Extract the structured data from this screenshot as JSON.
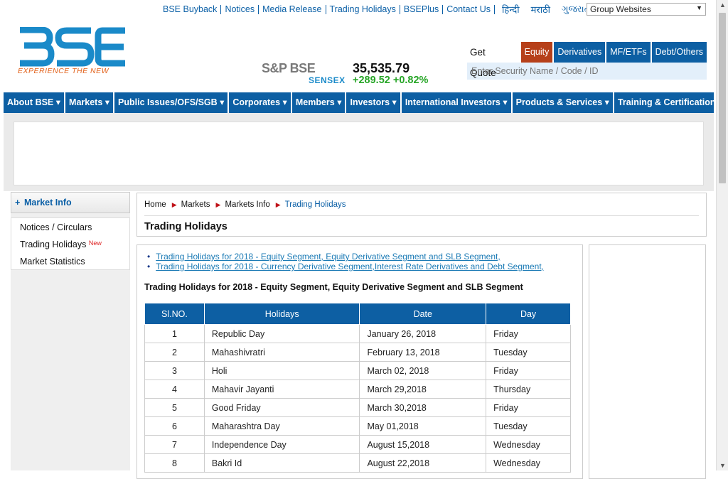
{
  "top_links": [
    "BSE Buyback",
    "Notices",
    "Media Release",
    "Trading Holidays",
    "BSEPlus",
    "Contact Us"
  ],
  "languages": [
    "हिन्दी",
    "मराठी",
    "ગુજરાતી"
  ],
  "group_websites": "Group Websites",
  "logo": {
    "text": "BSE",
    "tagline": "EXPERIENCE THE NEW",
    "color": "#1a8ac9"
  },
  "sensex": {
    "brand": "S&P BSE",
    "label": "SENSEX",
    "value": "35,535.79",
    "change": "+289.52 +0.82%"
  },
  "quote": {
    "get_quote": "Get Quote",
    "tabs": [
      "Equity",
      "Derivatives",
      "MF/ETFs",
      "Debt/Others"
    ],
    "active_tab": "Equity",
    "placeholder": "Enter Security Name / Code / ID"
  },
  "nav": [
    "About BSE ▾",
    "Markets ▾",
    "Public Issues/OFS/SGB ▾",
    "Corporates ▾",
    "Members ▾",
    "Investors ▾",
    "International Investors ▾",
    "Products & Services ▾",
    "Training & Certification ▾"
  ],
  "sidebar": {
    "heading": "Market Info",
    "items": [
      "Notices / Circulars",
      "Trading Holidays",
      "Market Statistics"
    ],
    "new_badge": "New"
  },
  "breadcrumb": [
    "Home",
    "Markets",
    "Markets Info",
    "Trading Holidays"
  ],
  "page_title": "Trading Holidays",
  "links": [
    "Trading Holidays for 2018 - Equity Segment, Equity Derivative Segment and SLB Segment,",
    "Trading Holidays for 2018 - Currency Derivative Segment,Interest Rate Derivatives and Debt Segment,"
  ],
  "section_heading": "Trading Holidays for 2018 - Equity Segment, Equity Derivative Segment and SLB Segment",
  "table": {
    "headers": [
      "Sl.NO.",
      "Holidays",
      "Date",
      "Day"
    ],
    "rows": [
      [
        "1",
        "Republic Day",
        "January 26, 2018",
        "Friday"
      ],
      [
        "2",
        "Mahashivratri",
        "February 13, 2018",
        "Tuesday"
      ],
      [
        "3",
        "Holi",
        "March 02, 2018",
        "Friday"
      ],
      [
        "4",
        "Mahavir Jayanti",
        "March 29,2018",
        "Thursday"
      ],
      [
        "5",
        "Good Friday",
        "March 30,2018",
        "Friday"
      ],
      [
        "6",
        "Maharashtra Day",
        "May 01,2018",
        "Tuesday"
      ],
      [
        "7",
        "Independence Day",
        "August 15,2018",
        "Wednesday"
      ],
      [
        "8",
        "Bakri Id",
        "August 22,2018",
        "Wednesday"
      ]
    ]
  }
}
